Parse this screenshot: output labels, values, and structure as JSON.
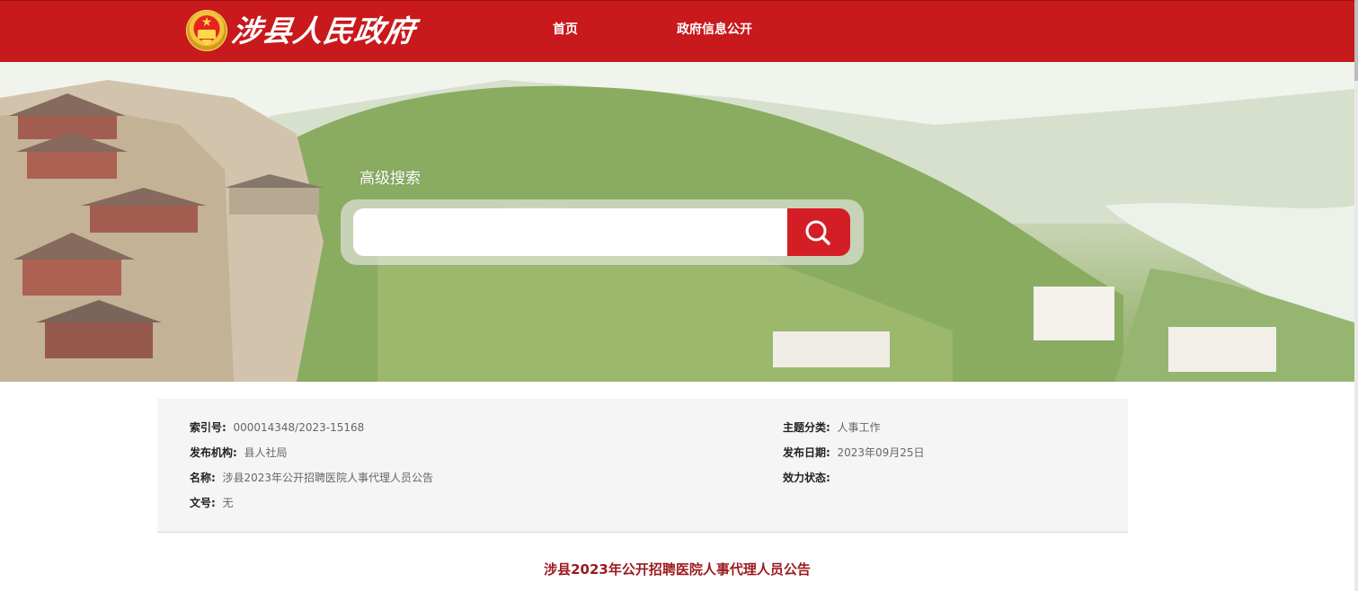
{
  "header": {
    "site_name": "涉县人民政府",
    "nav": [
      "首页",
      "政府信息公开"
    ],
    "brand_color": "#c8191c"
  },
  "search": {
    "label": "高级搜索",
    "placeholder": "",
    "button_icon": "search-icon",
    "button_color": "#d41e25"
  },
  "meta": {
    "index_no": {
      "label": "索引号:",
      "value": "000014348/2023-15168"
    },
    "publisher": {
      "label": "发布机构:",
      "value": "县人社局"
    },
    "name": {
      "label": "名称:",
      "value": "涉县2023年公开招聘医院人事代理人员公告"
    },
    "doc_no": {
      "label": "文号:",
      "value": "无"
    },
    "topic": {
      "label": "主题分类:",
      "value": "人事工作"
    },
    "date": {
      "label": "发布日期:",
      "value": "2023年09月25日"
    },
    "validity": {
      "label": "效力状态:",
      "value": ""
    }
  },
  "document": {
    "title": "涉县2023年公开招聘医院人事代理人员公告",
    "title_color": "#9b1a1d"
  }
}
